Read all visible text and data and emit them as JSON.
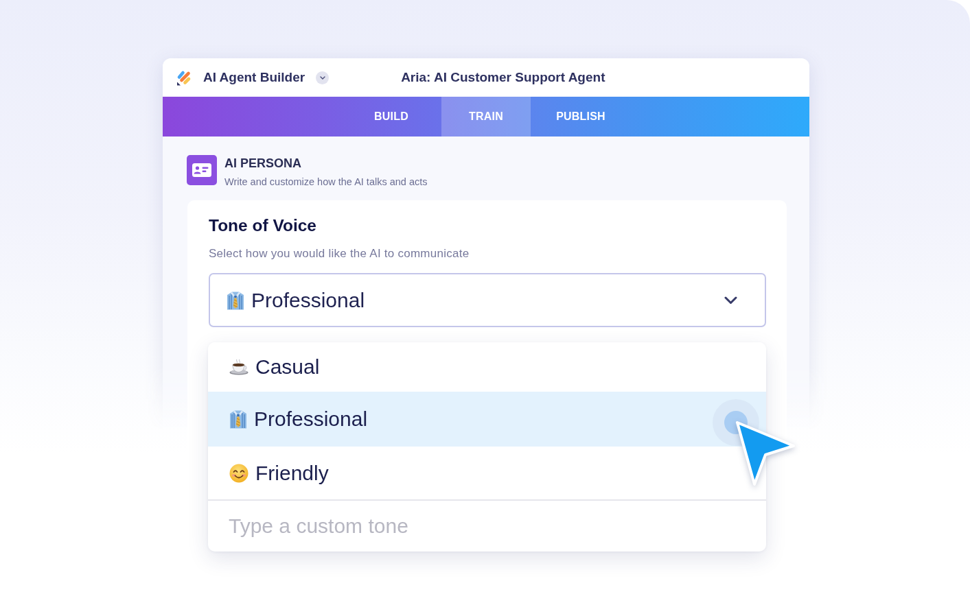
{
  "header": {
    "app_name": "AI Agent Builder",
    "agent_title": "Aria: AI Customer Support Agent"
  },
  "tabs": [
    {
      "label": "BUILD",
      "selected": false
    },
    {
      "label": "TRAIN",
      "selected": true
    },
    {
      "label": "PUBLISH",
      "selected": false
    }
  ],
  "section": {
    "title": "AI PERSONA",
    "subtitle": "Write and customize how the AI talks and acts"
  },
  "tone_card": {
    "title": "Tone of Voice",
    "description": "Select how you would like the AI to communicate",
    "select": {
      "value": "Professional",
      "expanded": true
    },
    "options": [
      {
        "label": "Casual",
        "selected": false
      },
      {
        "label": "Professional",
        "selected": true
      },
      {
        "label": "Friendly",
        "selected": false
      }
    ],
    "custom_tone": {
      "placeholder": "Type a custom tone"
    }
  }
}
